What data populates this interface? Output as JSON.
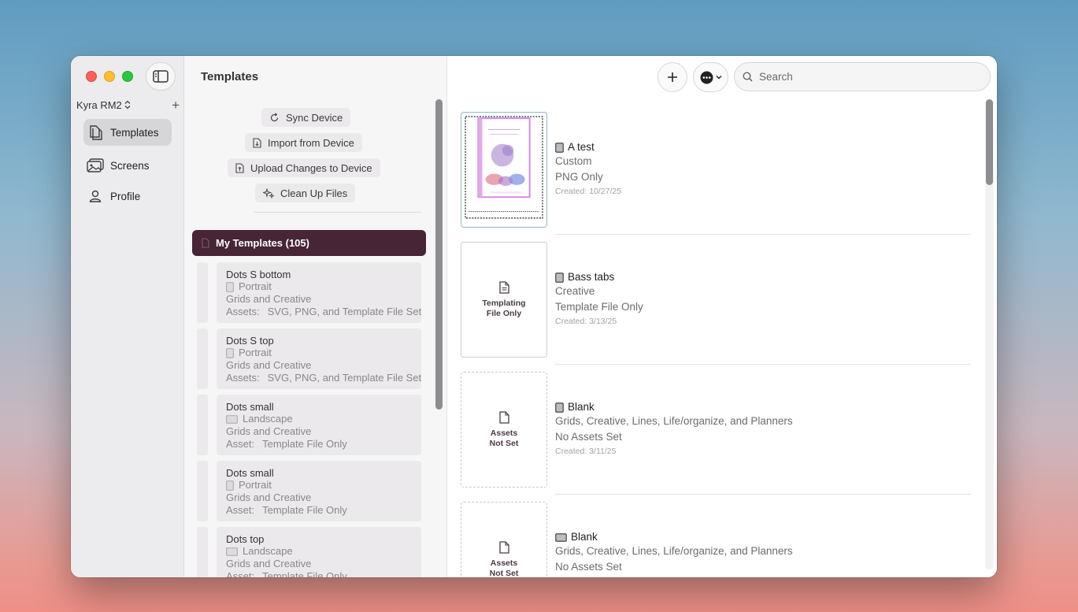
{
  "colors": {
    "accent": "#472436",
    "traffic_red": "#fe5f57",
    "traffic_yellow": "#febc2e",
    "traffic_green": "#28c840"
  },
  "sidebar": {
    "device": "Kyra RM2",
    "items": [
      {
        "label": "Templates",
        "icon": "templates-icon",
        "active": true
      },
      {
        "label": "Screens",
        "icon": "screens-icon",
        "active": false
      },
      {
        "label": "Profile",
        "icon": "profile-icon",
        "active": false
      }
    ]
  },
  "middle": {
    "title": "Templates",
    "actions": {
      "sync": "Sync Device",
      "import": "Import from Device",
      "upload": "Upload Changes to Device",
      "cleanup": "Clean Up Files"
    },
    "group": "My Templates (105)",
    "list": [
      {
        "name": "Dots S bottom",
        "orientation": "Portrait",
        "categories": "Grids and Creative",
        "assets_label": "Assets:",
        "assets": "SVG, PNG, and Template File Set"
      },
      {
        "name": "Dots S top",
        "orientation": "Portrait",
        "categories": "Grids and Creative",
        "assets_label": "Assets:",
        "assets": "SVG, PNG, and Template File Set"
      },
      {
        "name": "Dots small",
        "orientation": "Landscape",
        "categories": "Grids and Creative",
        "assets_label": "Asset:",
        "assets": "Template File Only"
      },
      {
        "name": "Dots small",
        "orientation": "Portrait",
        "categories": "Grids and Creative",
        "assets_label": "Asset:",
        "assets": "Template File Only"
      },
      {
        "name": "Dots top",
        "orientation": "Landscape",
        "categories": "Grids and Creative",
        "assets_label": "Asset:",
        "assets": "Template File Only"
      }
    ]
  },
  "right": {
    "search_placeholder": "Search",
    "cards": [
      {
        "title": "A test",
        "category": "Custom",
        "assets": "PNG Only",
        "created": "Created: 10/27/25",
        "thumb_type": "image",
        "thumb_text": "",
        "orientation": "portrait"
      },
      {
        "title": "Bass tabs",
        "category": "Creative",
        "assets": "Template File Only",
        "created": "Created: 3/13/25",
        "thumb_type": "solid",
        "thumb_text": "Templating\nFile Only",
        "orientation": "portrait"
      },
      {
        "title": "Blank",
        "category": "Grids, Creative, Lines, Life/organize, and Planners",
        "assets": "No Assets Set",
        "created": "Created: 3/11/25",
        "thumb_type": "dashed",
        "thumb_text": "Assets\nNot Set",
        "orientation": "portrait"
      },
      {
        "title": "Blank",
        "category": "Grids, Creative, Lines, Life/organize, and Planners",
        "assets": "No Assets Set",
        "created": "",
        "thumb_type": "dashed",
        "thumb_text": "Assets\nNot Set",
        "orientation": "landscape"
      }
    ]
  }
}
